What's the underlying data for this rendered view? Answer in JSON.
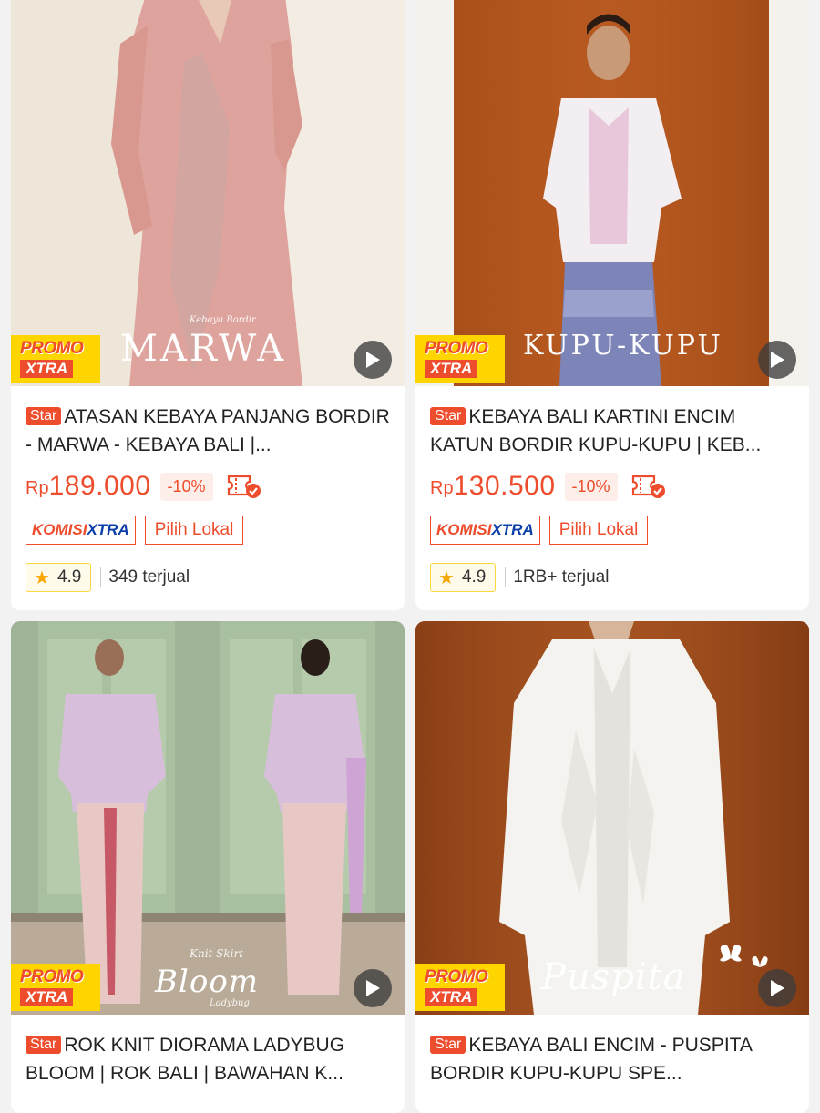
{
  "products": [
    {
      "title": "ATASAN KEBAYA PANJANG BORDIR - MARWA - KEBAYA BALI | KEBAYA MODERN",
      "title_visible": "ATASAN KEBAYA PANJANG BORDIR - MARWA - KEBAYA BALI |...",
      "star_badge": "Star",
      "currency": "Rp",
      "price": "189.000",
      "discount": "-10%",
      "komisi_a": "KOMISI",
      "komisi_b": "XTRA",
      "lokal": "Pilih Lokal",
      "rating": "4.9",
      "sold": "349 terjual",
      "promo_top": "PROMO",
      "promo_bottom": "XTRA",
      "overlay_sub": "Kebaya Bordir",
      "overlay_main": "MARWA"
    },
    {
      "title_visible": "KEBAYA BALI KARTINI ENCIM KATUN BORDIR KUPU-KUPU | KEB...",
      "star_badge": "Star",
      "currency": "Rp",
      "price": "130.500",
      "discount": "-10%",
      "komisi_a": "KOMISI",
      "komisi_b": "XTRA",
      "lokal": "Pilih Lokal",
      "rating": "4.9",
      "sold": "1RB+ terjual",
      "promo_top": "PROMO",
      "promo_bottom": "XTRA",
      "overlay_main": "KUPU-KUPU"
    },
    {
      "title_visible": "ROK KNIT DIORAMA LADYBUG BLOOM | ROK BALI | BAWAHAN K...",
      "star_badge": "Star",
      "promo_top": "PROMO",
      "promo_bottom": "XTRA",
      "overlay_sub": "Knit Skirt",
      "overlay_main": "Bloom",
      "overlay_sub2": "Ladybug"
    },
    {
      "title_visible": "KEBAYA BALI ENCIM - PUSPITA BORDIR KUPU-KUPU SPE...",
      "star_badge": "Star",
      "promo_top": "PROMO",
      "promo_bottom": "XTRA",
      "overlay_main": "Puspita"
    }
  ],
  "colors": {
    "accent": "#ee4d2d",
    "promo_yellow": "#ffd500",
    "rating_star": "#f6a700",
    "komisi_blue": "#0b3ea8"
  },
  "icons": {
    "voucher": "voucher-check-icon",
    "play": "play-icon",
    "star": "star-icon"
  }
}
